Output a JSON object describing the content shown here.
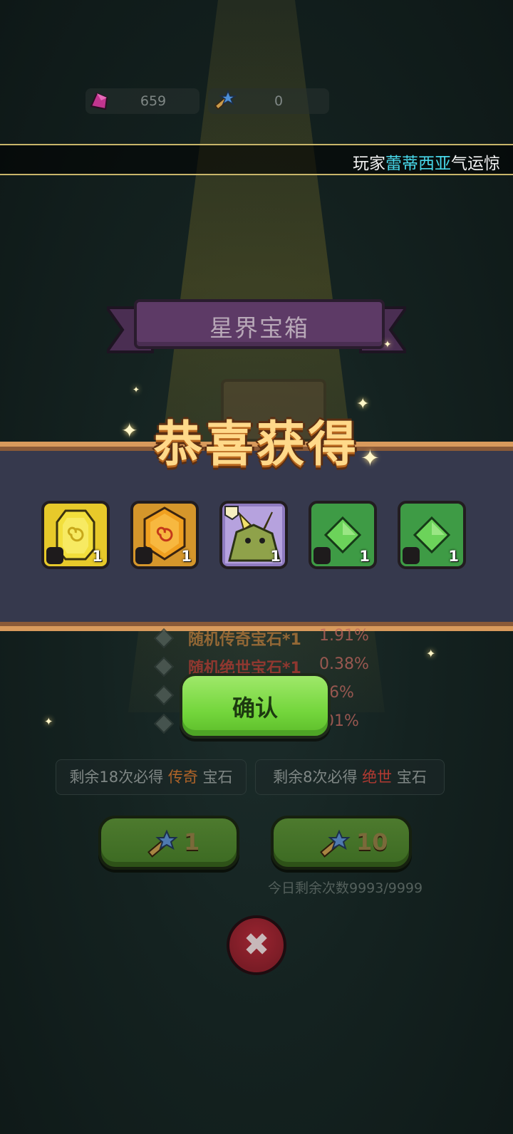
{
  "currency": {
    "gems": "659",
    "keys": "0"
  },
  "ticker": {
    "prefix": "玩家",
    "player": "蕾蒂西亚",
    "suffix": "气运惊"
  },
  "banner": {
    "title": "星界宝箱"
  },
  "reward": {
    "heading": "恭喜获得",
    "items": [
      {
        "name": "yellow-gem",
        "count": "1",
        "badge": "hook-icon",
        "color": "#e7c92a"
      },
      {
        "name": "orange-gem",
        "count": "1",
        "badge": "boot-icon",
        "color": "#d5962b"
      },
      {
        "name": "dragon-portrait",
        "count": "1",
        "badge": "",
        "color": "#8f7bc0"
      },
      {
        "name": "green-gem",
        "count": "1",
        "badge": "axe-icon",
        "color": "#3e9b45"
      },
      {
        "name": "green-gem",
        "count": "1",
        "badge": "crown-icon",
        "color": "#3e9b45"
      }
    ]
  },
  "odds": [
    {
      "name": "随机传奇宝石*1",
      "pct": "1.91%",
      "color": "#b87a3a"
    },
    {
      "name": "随机绝世宝石*1",
      "pct": "0.38%",
      "color": "#b33a32"
    },
    {
      "name": "",
      "pct": "06%",
      "color": "#b87a3a"
    },
    {
      "name": "",
      "pct": ".01%",
      "color": "#b87a3a"
    }
  ],
  "confirm": {
    "label": "确认"
  },
  "pity": {
    "left": {
      "prefix": "剩余18次必得",
      "rarity": "传奇",
      "suffix": "宝石"
    },
    "right": {
      "prefix": "剩余8次必得",
      "rarity": "绝世",
      "suffix": "宝石"
    }
  },
  "draws": {
    "single": "1",
    "ten": "10"
  },
  "remaining_today": "今日剩余次数9993/9999",
  "close": {
    "icon": "close-icon"
  }
}
